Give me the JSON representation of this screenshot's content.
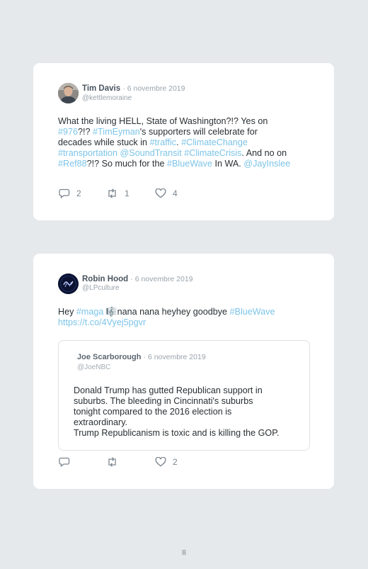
{
  "tweet1": {
    "author": "Tim Davis",
    "date": "· 6 novembre 2019",
    "handle": "@kettlemoraine",
    "line1": [
      {
        "t": "What the living HELL, State of Washington?!? Yes on",
        "link": false
      }
    ],
    "line2": [
      {
        "t": "#976",
        "link": true
      },
      {
        "t": "?!? ",
        "link": false
      },
      {
        "t": "#TimEyman",
        "link": true
      },
      {
        "t": "'s supporters will celebrate for",
        "link": false
      }
    ],
    "line3": [
      {
        "t": "decades while stuck in ",
        "link": false
      },
      {
        "t": "#traffic",
        "link": true
      },
      {
        "t": ". ",
        "link": false
      },
      {
        "t": "#ClimateChange",
        "link": true
      }
    ],
    "line4": [
      {
        "t": "#transportation @SoundTransit #ClimateCrisis",
        "link": true
      },
      {
        "t": ". And no on",
        "link": false
      }
    ],
    "line5": [
      {
        "t": "#Ref88",
        "link": true
      },
      {
        "t": "?!? So much for the ",
        "link": false
      },
      {
        "t": "#BlueWave",
        "link": true
      },
      {
        "t": " In WA. ",
        "link": false
      },
      {
        "t": "@JayInslee",
        "link": true
      }
    ],
    "replies": "2",
    "retweets": "1",
    "likes": "4"
  },
  "tweet2": {
    "author": "Robin Hood",
    "date": "· 6 novembre 2019",
    "handle": "@LPculture",
    "line1": [
      {
        "t": "Hey ",
        "link": false
      },
      {
        "t": "#maga",
        "link": true
      },
      {
        "t": " 🎼nana nana heyhey goodbye ",
        "link": false
      },
      {
        "t": "#BlueWave",
        "link": true
      }
    ],
    "line2": [
      {
        "t": "https://t.co/4Vyej5pgvr",
        "link": true
      }
    ],
    "quote": {
      "author": "Joe Scarborough",
      "date": "· 6 novembre 2019",
      "handle": "@JoeNBC",
      "lines": [
        "Donald Trump has gutted Republican support in",
        "suburbs. The bleeding in Cincinnati's suburbs",
        "tonight compared to the 2016 election is",
        "extraordinary.",
        "Trump Republicanism is toxic and is killing the GOP."
      ]
    },
    "replies": "",
    "retweets": "",
    "likes": "2"
  },
  "page_number": "8",
  "colors": {
    "link": "#7cc4e8",
    "background": "#e6e9eb",
    "card": "#ffffff"
  }
}
